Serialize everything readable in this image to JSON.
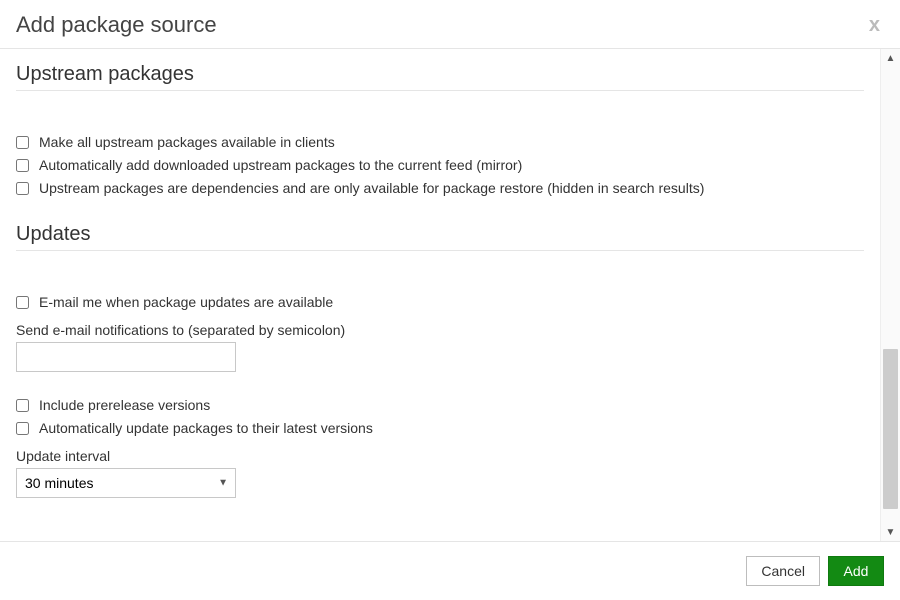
{
  "dialog": {
    "title": "Add package source",
    "close_label": "x"
  },
  "sections": {
    "upstream": {
      "heading": "Upstream packages",
      "options": {
        "make_available_label": "Make all upstream packages available in clients",
        "auto_add_mirror_label": "Automatically add downloaded upstream packages to the current feed (mirror)",
        "deps_only_label": "Upstream packages are dependencies and are only available for package restore (hidden in search results)"
      }
    },
    "updates": {
      "heading": "Updates",
      "email_notify_label": "E-mail me when package updates are available",
      "email_to_label": "Send e-mail notifications to (separated by semicolon)",
      "email_to_value": "",
      "include_prerelease_label": "Include prerelease versions",
      "auto_update_latest_label": "Automatically update packages to their latest versions",
      "update_interval_label": "Update interval",
      "update_interval_value": "30 minutes"
    }
  },
  "footer": {
    "cancel_label": "Cancel",
    "add_label": "Add"
  }
}
